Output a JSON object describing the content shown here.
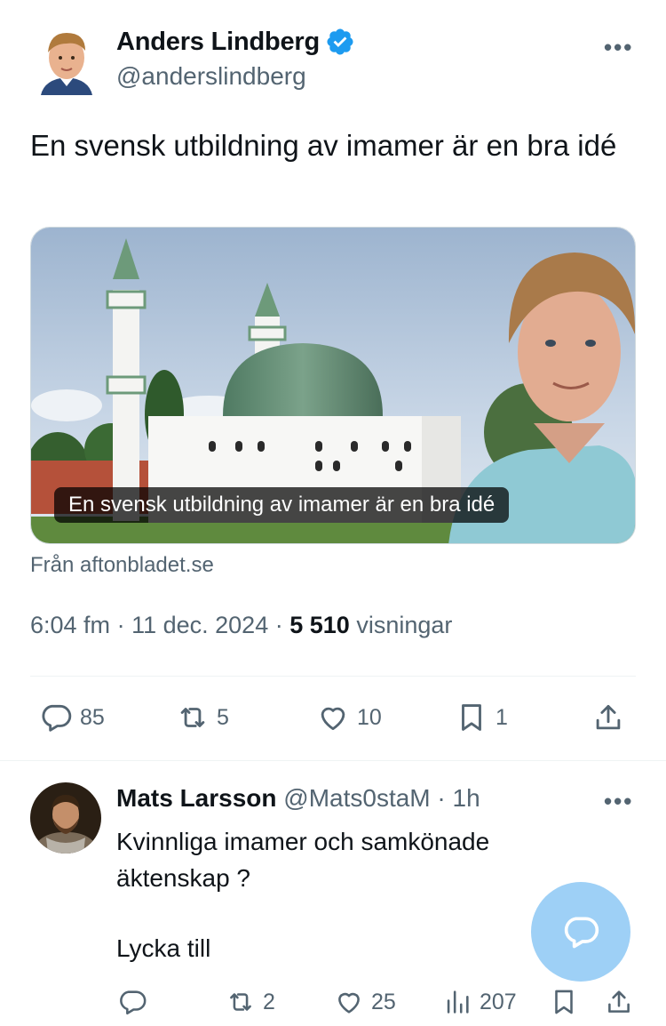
{
  "tweet": {
    "author_name": "Anders Lindberg",
    "author_handle": "@anderslindberg",
    "text": "En svensk utbildning av imamer är en bra idé",
    "card": {
      "caption": "En svensk utbildning av imamer är en bra idé",
      "source": "Från aftonbladet.se"
    },
    "time": "6:04 fm",
    "date": "11 dec. 2024",
    "views_count": "5 510",
    "views_label": "visningar",
    "separator": "·",
    "actions": {
      "replies": "85",
      "reposts": "5",
      "likes": "10",
      "bookmarks": "1"
    }
  },
  "reply": {
    "author_name": "Mats Larsson",
    "author_handle": "@Mats0staM",
    "time": "1h",
    "separator": "·",
    "line1": "Kvinnliga imamer och samkönade",
    "line2": "äktenskap ?",
    "line3": "Lycka till",
    "actions": {
      "reposts": "2",
      "likes": "25",
      "views": "207"
    }
  },
  "icons": {
    "verified": "verified-badge-icon",
    "more": "more-options-icon",
    "reply": "reply-icon",
    "repost": "repost-icon",
    "like": "heart-icon",
    "bookmark": "bookmark-icon",
    "share": "share-icon",
    "views": "views-icon",
    "compose": "compose-reply-icon"
  },
  "colors": {
    "accent": "#1d9bf0",
    "fab": "#9ed0f6",
    "secondary_text": "#536471",
    "primary_text": "#0f1419"
  }
}
